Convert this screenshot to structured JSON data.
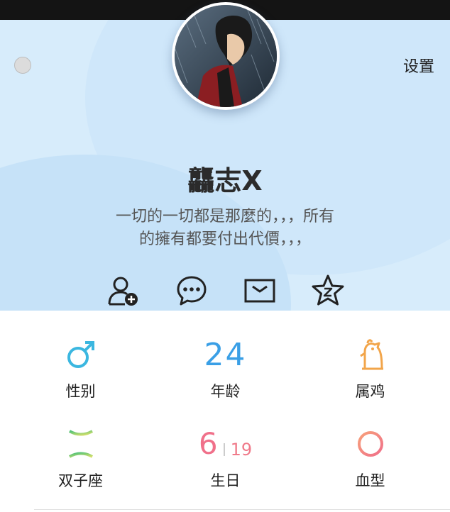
{
  "header": {
    "settings_label": "设置",
    "user_name": "龘志X",
    "bio_line1": "一切的一切都是那麼的，，，所有",
    "bio_line2": "的擁有都要付出代價，，，"
  },
  "actions": [
    {
      "icon": "add-friend-icon"
    },
    {
      "icon": "chat-bubble-icon"
    },
    {
      "icon": "mail-icon"
    },
    {
      "icon": "star-icon"
    }
  ],
  "info": {
    "gender_label": "性别",
    "age_value": "24",
    "age_label": "年龄",
    "zodiac_animal_label": "属鸡",
    "star_sign_label": "双子座",
    "birthday_month": "6",
    "birthday_day": "19",
    "birthday_label": "生日",
    "blood_type_label": "血型"
  },
  "colors": {
    "header_bg": "#d7ecfb",
    "gender": "#3bb7e0",
    "age": "#3a9fe6",
    "animal": "#f2a54a",
    "gemini": "#7ad07a",
    "birthday": "#f0708a",
    "blood": "#f59a8c"
  }
}
